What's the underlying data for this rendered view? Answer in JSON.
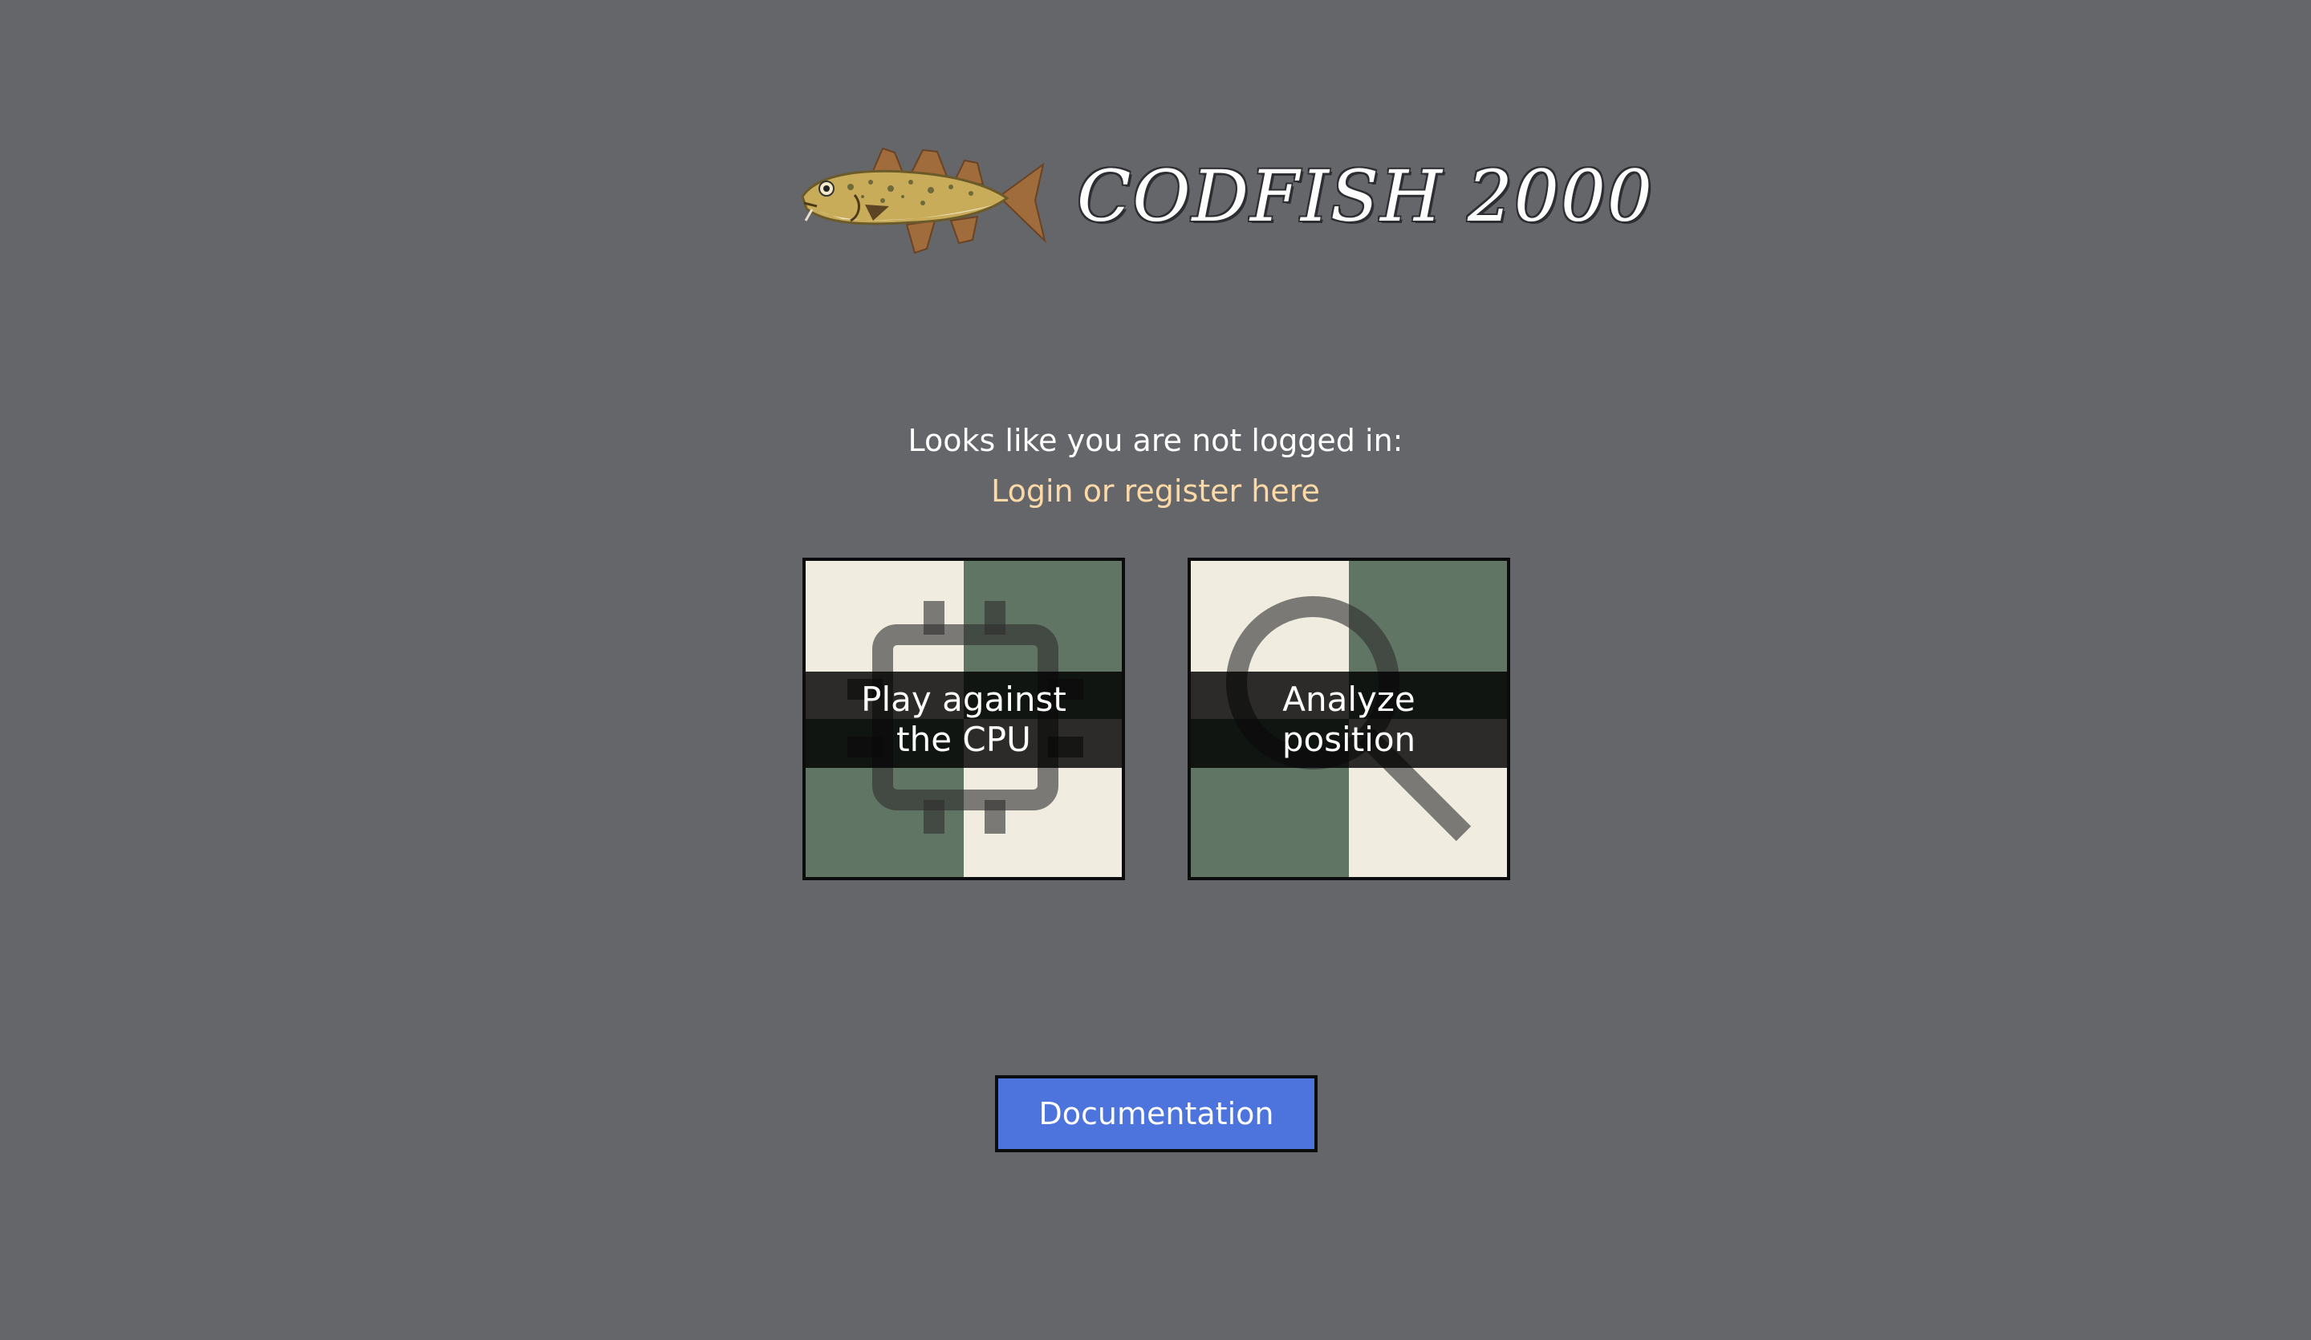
{
  "header": {
    "logo_icon": "codfish-logo-icon",
    "title": "CODFISH 2000"
  },
  "login": {
    "notice": "Looks like you are not logged in:",
    "link_label": "Login or register here"
  },
  "tiles": [
    {
      "icon": "cpu-chip-icon",
      "label": "Play against the CPU"
    },
    {
      "icon": "magnifier-icon",
      "label": "Analyze position"
    }
  ],
  "docs_button": {
    "label": "Documentation"
  },
  "colors": {
    "background": "#65666a",
    "board_light": "#f0ece0",
    "board_dark": "#617565",
    "link": "#fcd9a6",
    "button": "#4d73dc"
  }
}
